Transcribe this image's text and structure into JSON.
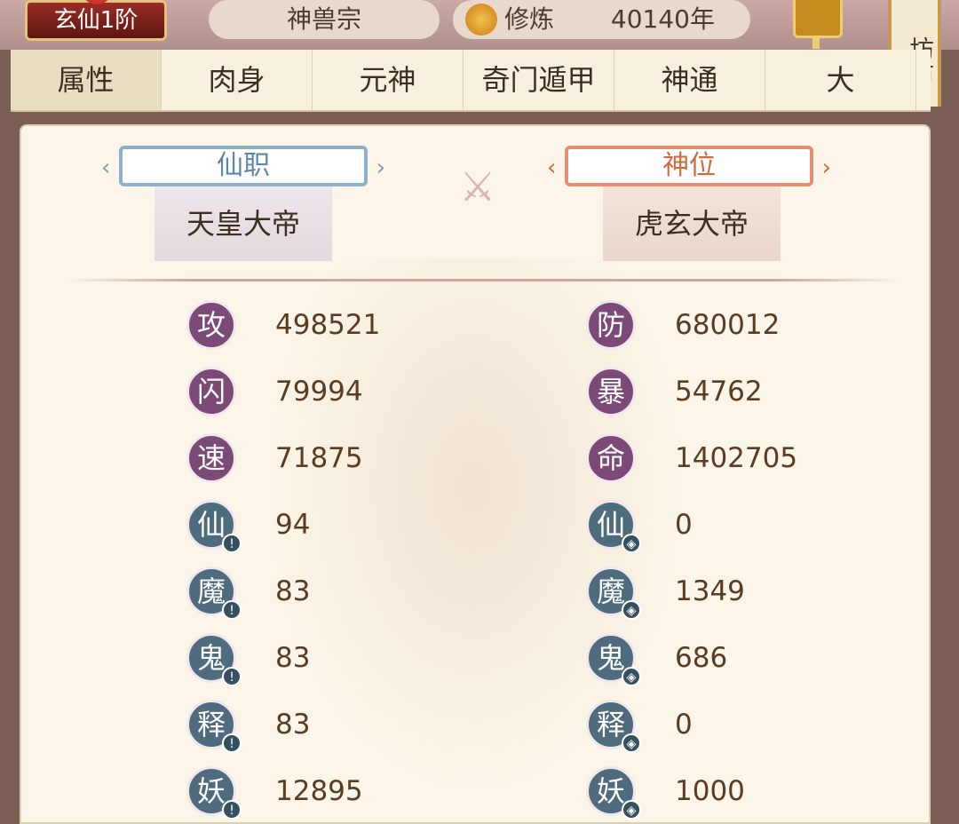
{
  "header": {
    "rank": "玄仙1阶",
    "sect": "神兽宗",
    "cultivation_label": "修炼",
    "cultivation_value": "40140年",
    "side_scroll_text": "坊市"
  },
  "tabs": [
    {
      "label": "属性",
      "active": true
    },
    {
      "label": "肉身"
    },
    {
      "label": "元神"
    },
    {
      "label": "奇门遁甲"
    },
    {
      "label": "神通"
    },
    {
      "label": "大"
    }
  ],
  "titles": {
    "left_ribbon": "仙职",
    "left_title": "天皇大帝",
    "right_ribbon": "神位",
    "right_title": "虎玄大帝"
  },
  "stats_left": [
    {
      "icon": "攻",
      "value": "498521"
    },
    {
      "icon": "闪",
      "value": "79994"
    },
    {
      "icon": "速",
      "value": "71875"
    },
    {
      "icon": "仙",
      "value": "94"
    },
    {
      "icon": "魔",
      "value": "83"
    },
    {
      "icon": "鬼",
      "value": "83"
    },
    {
      "icon": "释",
      "value": "83"
    },
    {
      "icon": "妖",
      "value": "12895"
    }
  ],
  "stats_right": [
    {
      "icon": "防",
      "value": "680012"
    },
    {
      "icon": "暴",
      "value": "54762"
    },
    {
      "icon": "命",
      "value": "1402705"
    },
    {
      "icon": "仙",
      "value": "0"
    },
    {
      "icon": "魔",
      "value": "1349"
    },
    {
      "icon": "鬼",
      "value": "686"
    },
    {
      "icon": "释",
      "value": "0"
    },
    {
      "icon": "妖",
      "value": "1000"
    }
  ],
  "colors": {
    "accent_purple": "#7b4a77",
    "accent_teal": "#4f6c7e",
    "value_brown": "#5b3b22"
  }
}
